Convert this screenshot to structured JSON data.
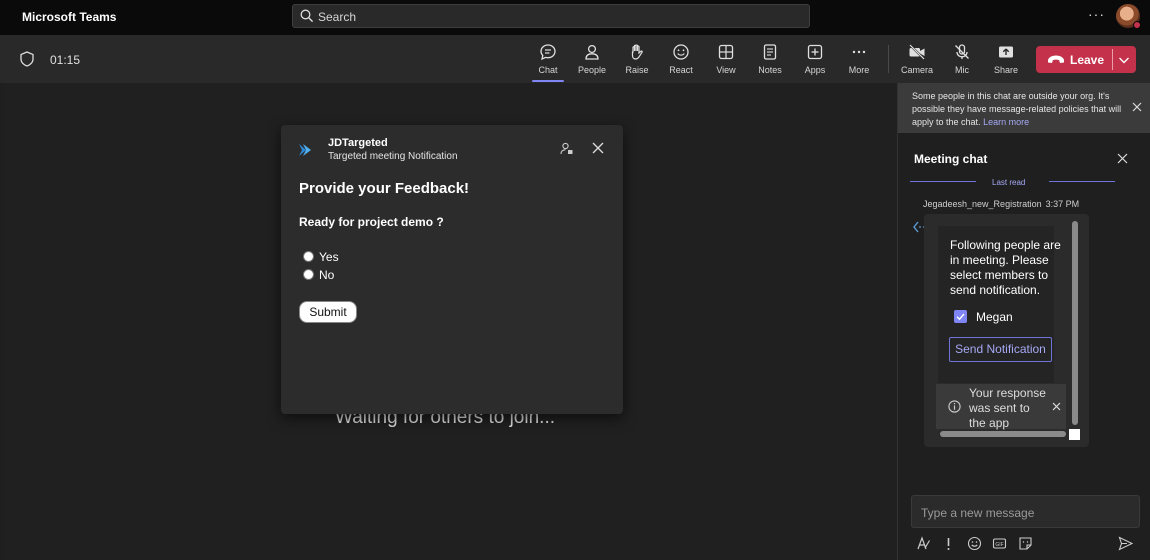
{
  "app": {
    "title": "Microsoft Teams"
  },
  "search": {
    "placeholder": "Search"
  },
  "meeting": {
    "timer": "01:15",
    "waiting_text": "Waiting for others to join...",
    "toolbar": [
      {
        "id": "chat",
        "label": "Chat",
        "icon": "chat-icon",
        "active": true
      },
      {
        "id": "people",
        "label": "People",
        "icon": "people-icon"
      },
      {
        "id": "raise",
        "label": "Raise",
        "icon": "raise-hand-icon"
      },
      {
        "id": "react",
        "label": "React",
        "icon": "react-icon"
      },
      {
        "id": "view",
        "label": "View",
        "icon": "view-icon"
      },
      {
        "id": "notes",
        "label": "Notes",
        "icon": "notes-icon"
      },
      {
        "id": "apps",
        "label": "Apps",
        "icon": "apps-icon"
      },
      {
        "id": "more",
        "label": "More",
        "icon": "more-icon"
      },
      {
        "id": "camera",
        "label": "Camera",
        "icon": "camera-off-icon"
      },
      {
        "id": "mic",
        "label": "Mic",
        "icon": "mic-off-icon"
      },
      {
        "id": "share",
        "label": "Share",
        "icon": "share-icon"
      }
    ],
    "leave_label": "Leave",
    "leave_color": "#c4314b"
  },
  "dialog": {
    "app_name": "JDTargeted",
    "subtitle": "Targeted meeting Notification",
    "heading": "Provide your Feedback!",
    "question": "Ready for project demo ?",
    "options": [
      "Yes",
      "No"
    ],
    "submit_label": "Submit"
  },
  "chat": {
    "banner_text": "Some people in this chat are outside your org. It's possible they have message-related policies that will apply to the chat.",
    "banner_link": "Learn more",
    "title": "Meeting chat",
    "last_read": "Last read",
    "sender": "Jegadeesh_new_Registration",
    "time": "3:37 PM",
    "card_text": "Following people are in meeting. Please select members to send notification.",
    "member": "Megan",
    "send_label": "Send Notification",
    "toast": "Your response was sent to the app",
    "compose_placeholder": "Type a new message",
    "accent_color": "#7f85f5"
  }
}
